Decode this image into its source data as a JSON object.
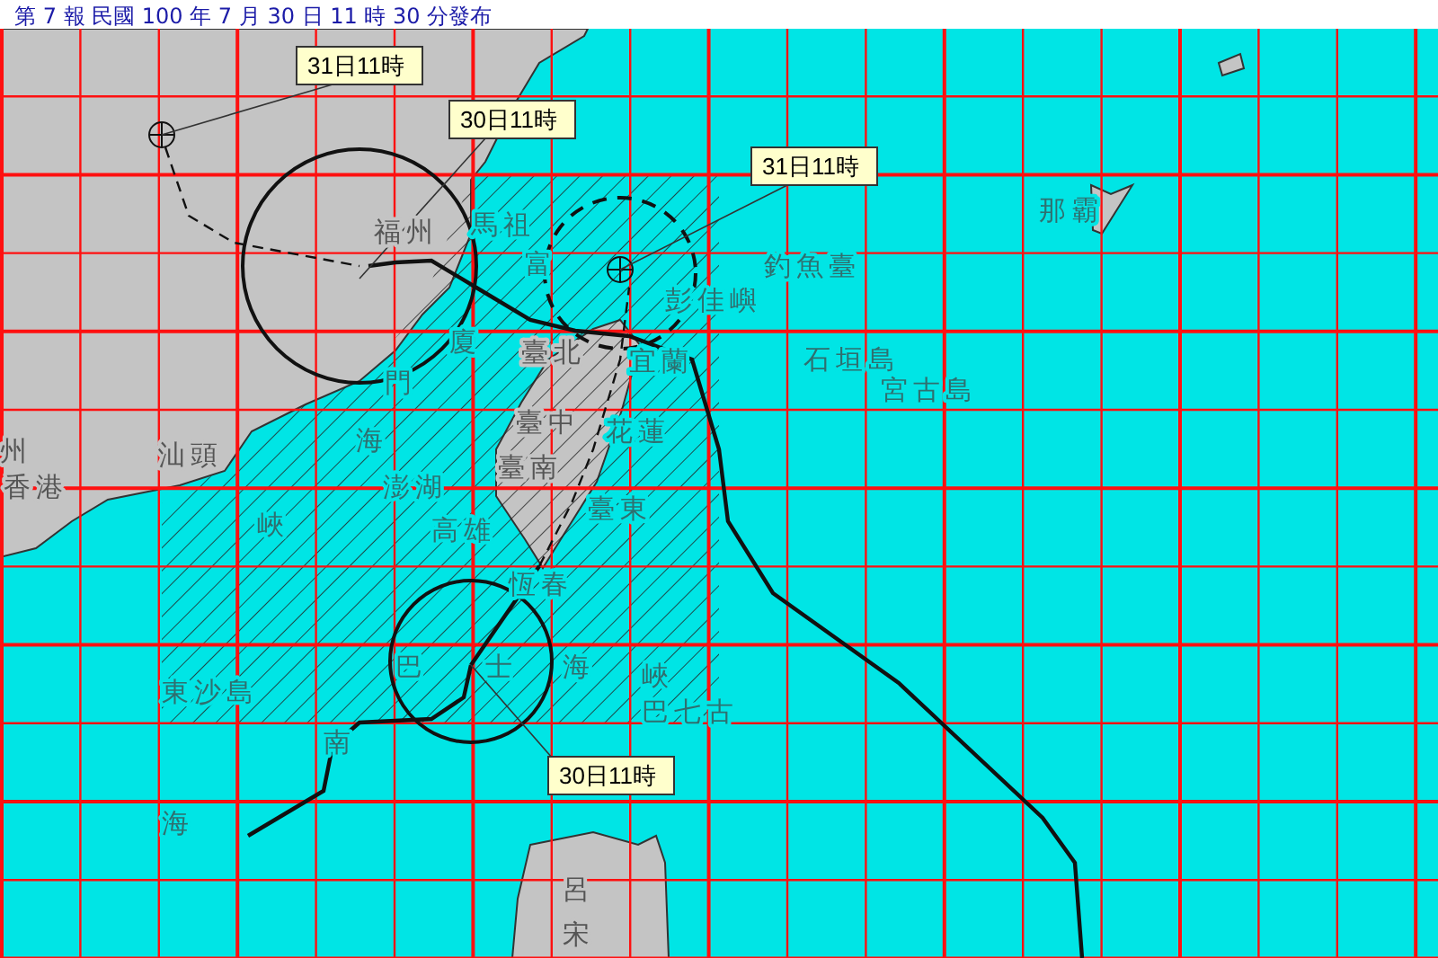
{
  "header": {
    "text": "第 7 報  民國 100 年 7 月 30 日 11 時 30 分發布"
  },
  "time_labels": [
    {
      "text": "31日11時"
    },
    {
      "text": "30日11時"
    },
    {
      "text": "31日11時"
    },
    {
      "text": "30日11時"
    }
  ],
  "place_names": [
    {
      "text": "州",
      "kind": "land"
    },
    {
      "text": "香港",
      "kind": "land"
    },
    {
      "text": "汕頭",
      "kind": "land"
    },
    {
      "text": "福州",
      "kind": "land"
    },
    {
      "text": "馬祖",
      "kind": "sea"
    },
    {
      "text": "富",
      "kind": "sea"
    },
    {
      "text": "彭佳嶼",
      "kind": "sea"
    },
    {
      "text": "釣魚臺",
      "kind": "sea"
    },
    {
      "text": "臺北",
      "kind": "land"
    },
    {
      "text": "宜蘭",
      "kind": "sea"
    },
    {
      "text": "臺中",
      "kind": "land"
    },
    {
      "text": "花蓮",
      "kind": "sea"
    },
    {
      "text": "石垣島",
      "kind": "sea"
    },
    {
      "text": "宮古島",
      "kind": "sea"
    },
    {
      "text": "那霸",
      "kind": "sea"
    },
    {
      "text": "廈",
      "kind": "sea"
    },
    {
      "text": "門",
      "kind": "sea"
    },
    {
      "text": "海",
      "kind": "sea"
    },
    {
      "text": "峽",
      "kind": "sea"
    },
    {
      "text": "澎湖",
      "kind": "sea"
    },
    {
      "text": "臺南",
      "kind": "land"
    },
    {
      "text": "高雄",
      "kind": "sea"
    },
    {
      "text": "臺東",
      "kind": "sea"
    },
    {
      "text": "恆春",
      "kind": "sea"
    },
    {
      "text": "東沙島",
      "kind": "sea"
    },
    {
      "text": "巴",
      "kind": "sea"
    },
    {
      "text": "士",
      "kind": "sea"
    },
    {
      "text": "海",
      "kind": "sea"
    },
    {
      "text": "峽",
      "kind": "sea"
    },
    {
      "text": "巴七古",
      "kind": "sea"
    },
    {
      "text": "南",
      "kind": "sea"
    },
    {
      "text": "海",
      "kind": "sea"
    },
    {
      "text": "呂",
      "kind": "land"
    },
    {
      "text": "宋",
      "kind": "land"
    }
  ]
}
